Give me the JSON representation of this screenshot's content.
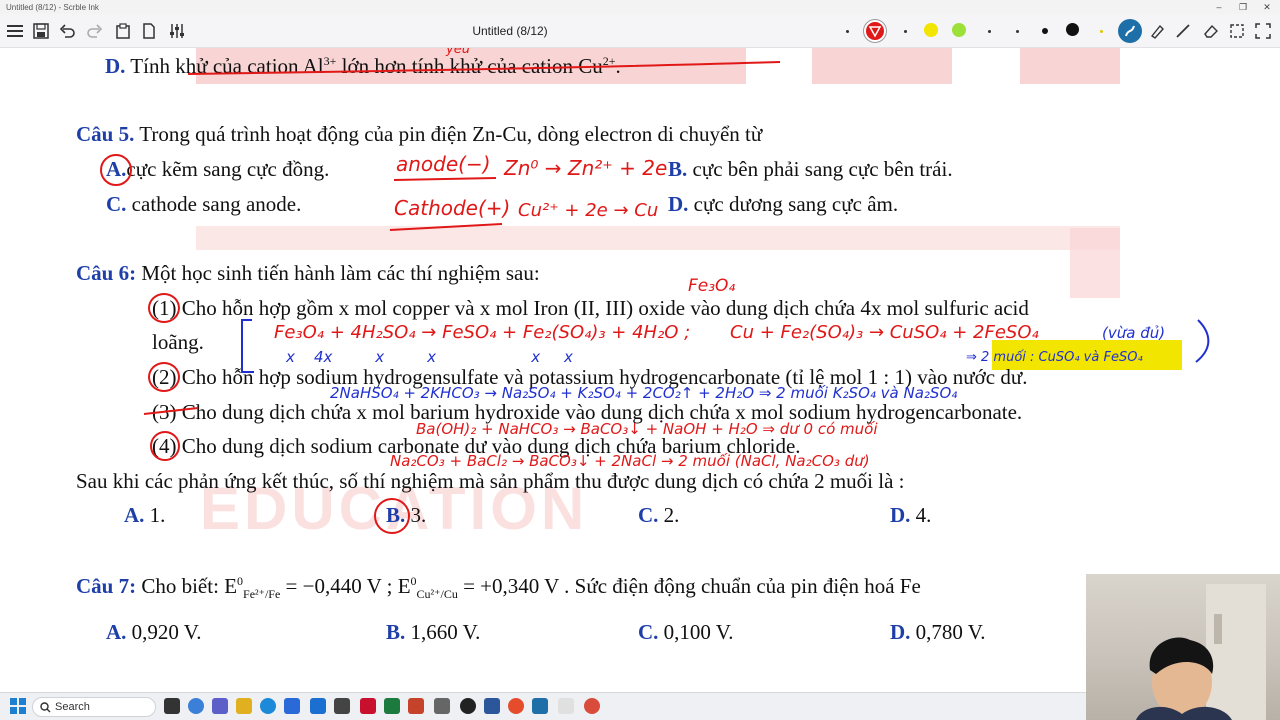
{
  "window": {
    "title_small": "Untitled (8/12) - Scrble Ink",
    "doc_title": "Untitled (8/12)",
    "minimize": "–",
    "maximize": "❐",
    "close": "✕"
  },
  "toolbar": {
    "pen_colors": [
      "#e01818",
      "#f2e600",
      "#9ee03a",
      "#111111",
      "#1e7fd0"
    ],
    "icons": [
      "menu-icon",
      "save-icon",
      "undo-icon",
      "redo-icon",
      "paste-icon",
      "page-icon",
      "settings-icon",
      "pen-icon",
      "line-icon",
      "eraser-icon",
      "select-icon",
      "fullscreen-icon"
    ]
  },
  "document": {
    "q4_option_d": {
      "label": "D.",
      "text": "Tính khử của cation Al",
      "sup1": "3+",
      "text2": " lớn hơn tính khử của cation Cu",
      "sup2": "2+",
      "end": "."
    },
    "q5": {
      "label": "Câu 5.",
      "stem": "Trong quá trình hoạt động của pin điện Zn-Cu, dòng electron di chuyển từ",
      "options": [
        {
          "label": "A.",
          "text": "cực kẽm sang cực đồng."
        },
        {
          "label": "B.",
          "text": "cực bên phải sang cực bên trái."
        },
        {
          "label": "C.",
          "text": "cathode sang anode."
        },
        {
          "label": "D.",
          "text": "cực dương sang cực âm."
        }
      ]
    },
    "q6": {
      "label": "Câu 6:",
      "stem": "Một học sinh tiến hành làm các thí nghiệm sau:",
      "items": [
        {
          "num": "(1)",
          "text": "Cho hỗn hợp gồm x mol copper và x mol Iron (II, III) oxide vào dung dịch chứa 4x mol sulfuric acid"
        },
        {
          "num": "",
          "text": "loãng."
        },
        {
          "num": "(2)",
          "text": "Cho hỗn hợp sodium hydrogensulfate và potassium hydrogencarbonate (tỉ lệ mol 1 : 1) vào nước dư."
        },
        {
          "num": "(3)",
          "text": "Cho dung dịch chứa x mol barium hydroxide vào dung dịch chứa x mol sodium hydrogencarbonate."
        },
        {
          "num": "(4)",
          "text": "Cho dung dịch sodium carbonate dư vào dung dịch chứa barium chloride."
        }
      ],
      "question": "Sau khi các phản ứng kết thúc, số thí nghiệm mà sản phẩm thu được dung dịch có chứa 2 muối là :",
      "options": [
        {
          "label": "A.",
          "text": " 1."
        },
        {
          "label": "B.",
          "text": " 3."
        },
        {
          "label": "C.",
          "text": " 2."
        },
        {
          "label": "D.",
          "text": " 4."
        }
      ]
    },
    "q7": {
      "label": "Câu 7:",
      "stem_a": "Cho biết:",
      "e1_sub": "Fe²⁺/Fe",
      "e1_val": "= −0,440 V ;",
      "e2_sub": "Cu²⁺/Cu",
      "e2_val": "= +0,340 V . Sức điện động chuẩn của pin điện hoá Fe",
      "options": [
        {
          "label": "A.",
          "text": "0,920 V."
        },
        {
          "label": "B.",
          "text": "1,660 V."
        },
        {
          "label": "C.",
          "text": "0,100 V."
        },
        {
          "label": "D.",
          "text": "0,780 V."
        }
      ]
    },
    "watermark": "EDUCATION",
    "annotations": {
      "yeu": "yếu",
      "anode": "anode(−)",
      "anode_rxn": "Zn⁰ → Zn²⁺ + 2e",
      "cathode": "Cathode(+)",
      "cathode_rxn": "Cu²⁺ + 2e → Cu",
      "fe3o4": "Fe₃O₄",
      "r1": "Fe₃O₄ + 4H₂SO₄ → FeSO₄ + Fe₂(SO₄)₃ + 4H₂O ;",
      "r1b": "Cu + Fe₂(SO₄)₃ → CuSO₄ + 2FeSO₄",
      "r1_note": "(vừa đủ)",
      "r1_vals": "x    4x         x         x                    x     x",
      "r1_hl": "⇒ 2 muối : CuSO₄ và FeSO₄",
      "r2": "2NaHSO₄ + 2KHCO₃ → Na₂SO₄ + K₂SO₄ + 2CO₂↑ + 2H₂O ⇒ 2 muối K₂SO₄ và Na₂SO₄",
      "r3": "Ba(OH)₂ + NaHCO₃ → BaCO₃↓ + NaOH + H₂O ⇒ dư 0 có muối",
      "r4": "Na₂CO₃ + BaCl₂ → BaCO₃↓ + 2NaCl → 2 muối (NaCl, Na₂CO₃ dư)"
    }
  },
  "taskbar": {
    "search_placeholder": "Search"
  }
}
